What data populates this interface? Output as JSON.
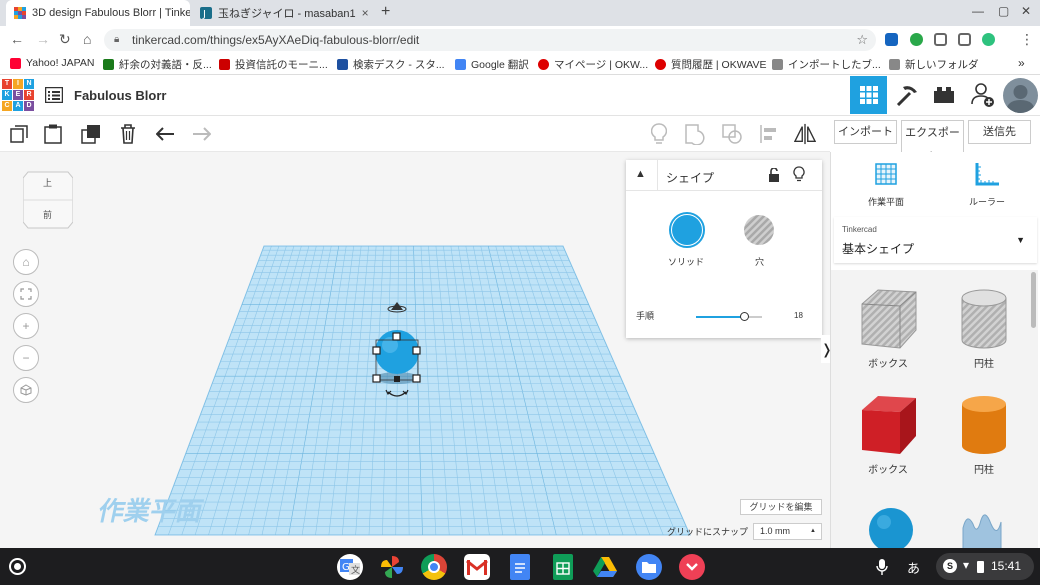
{
  "browser": {
    "tabs": [
      {
        "title": "3D design Fabulous Blorr | Tinke",
        "close": "×"
      },
      {
        "title": "玉ねぎジャイロ - masaban1",
        "close": "×"
      }
    ],
    "new_tab": "+",
    "window_controls": [
      "—",
      "▢",
      "✕"
    ],
    "url": "tinkercad.com/things/ex5AyXAeDiq-fabulous-blorr/edit",
    "bookmarks": [
      {
        "label": "Yahoo! JAPAN",
        "color": "#ff0033"
      },
      {
        "label": "紆余の対義語・反...",
        "color": "#1a7a1a"
      },
      {
        "label": "投資信託のモーニ...",
        "color": "#c00"
      },
      {
        "label": "検索デスク - スタ...",
        "color": "#1e50a0"
      },
      {
        "label": "Google 翻訳",
        "color": "#4285f4"
      },
      {
        "label": "マイページ | OKW...",
        "color": "#d00"
      },
      {
        "label": "質問履歴 | OKWAVE",
        "color": "#d00"
      },
      {
        "label": "インポートしたブ...",
        "color": "#666"
      },
      {
        "label": "新しいフォルダ",
        "color": "#666"
      }
    ],
    "bookmarks_more": "»"
  },
  "app": {
    "logo_letters": [
      "TIN",
      "KER",
      "CAD"
    ],
    "logo_colors": [
      "#e8432f",
      "#f5a623",
      "#1fa1e0",
      "#7b4fa0"
    ],
    "design_title": "Fabulous Blorr",
    "import_label": "インポート",
    "export_label": "エクスポート",
    "send_label": "送信先"
  },
  "viewcube": {
    "top": "上",
    "front": "前"
  },
  "shape_panel": {
    "title": "シェイプ",
    "solid_label": "ソリッド",
    "hole_label": "穴",
    "steps_label": "手順",
    "steps_value": "18",
    "steps_fraction": 0.72,
    "solid_color": "#1fa1e0"
  },
  "workplane": {
    "label": "作業平面",
    "edit_grid": "グリッドを編集",
    "snap_label": "グリッドにスナップ",
    "snap_value": "1.0 mm"
  },
  "right_panel": {
    "workplane_tool": "作業平面",
    "ruler_tool": "ルーラー",
    "library_source": "Tinkercad",
    "library_name": "基本シェイプ",
    "shapes": [
      {
        "label": "ボックス",
        "kind": "box-hole"
      },
      {
        "label": "円柱",
        "kind": "cylinder-hole"
      },
      {
        "label": "ボックス",
        "kind": "box-red"
      },
      {
        "label": "円柱",
        "kind": "cylinder-orange"
      }
    ]
  },
  "taskbar": {
    "time": "15:41",
    "ime": "あ",
    "badge": "S"
  }
}
